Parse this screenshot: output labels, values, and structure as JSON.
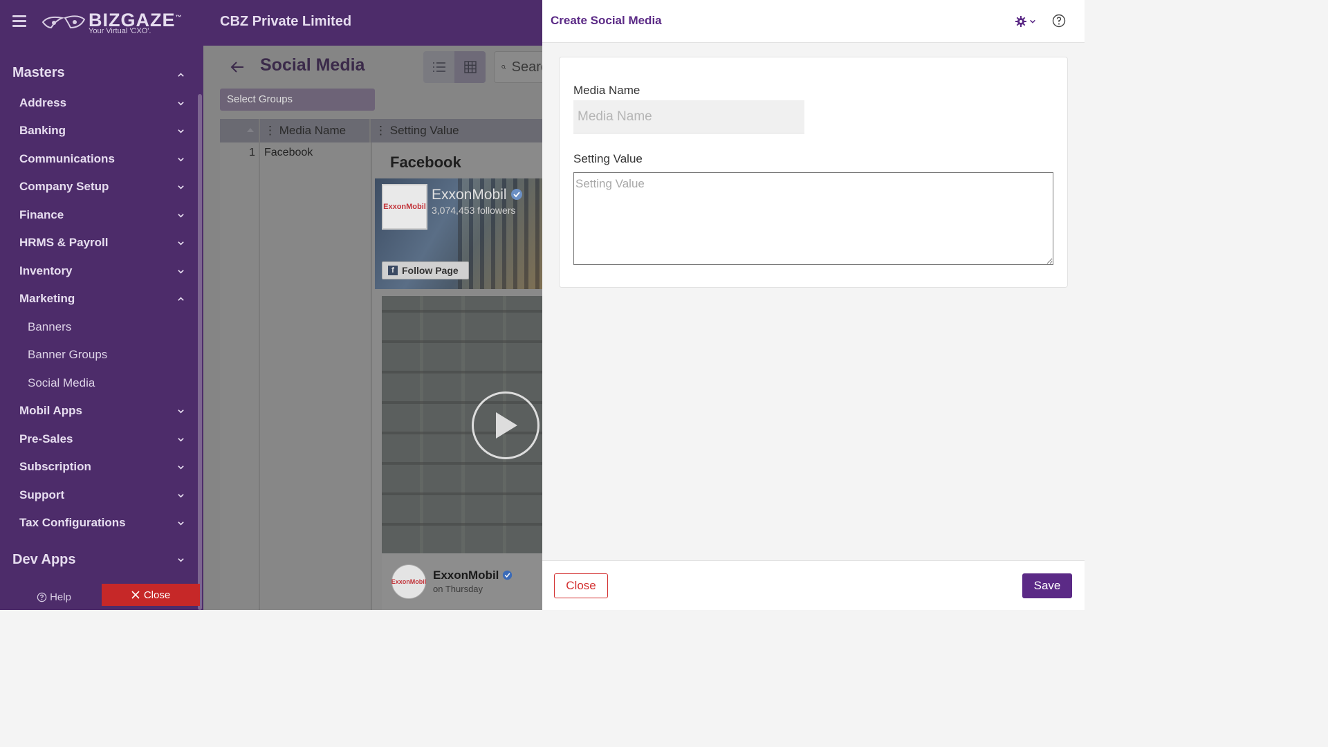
{
  "header": {
    "brand_name": "BIZGAZE",
    "brand_tm": "™",
    "brand_tagline": "Your Virtual 'CXO'.",
    "company": "CBZ Private Limited"
  },
  "sidebar": {
    "section": "Masters",
    "items": [
      {
        "label": "Address"
      },
      {
        "label": "Banking"
      },
      {
        "label": "Communications"
      },
      {
        "label": "Company Setup"
      },
      {
        "label": "Finance"
      },
      {
        "label": "HRMS & Payroll"
      },
      {
        "label": "Inventory"
      },
      {
        "label": "Marketing"
      },
      {
        "label": "Mobil Apps"
      },
      {
        "label": "Pre-Sales"
      },
      {
        "label": "Subscription"
      },
      {
        "label": "Support"
      },
      {
        "label": "Tax Configurations"
      }
    ],
    "marketing_children": [
      {
        "label": "Banners"
      },
      {
        "label": "Banner Groups"
      },
      {
        "label": "Social Media"
      }
    ],
    "dev_apps": "Dev Apps",
    "help": "Help",
    "close": "Close"
  },
  "main": {
    "title": "Social Media",
    "search_placeholder": "Search",
    "select_groups": "Select Groups",
    "columns": [
      "Media Name",
      "Setting Value"
    ],
    "rows": [
      {
        "num": "1",
        "name": "Facebook"
      }
    ],
    "preview": {
      "title": "Facebook",
      "page_name": "ExxonMobil",
      "followers": "3,074,453 followers",
      "follow_button": "Follow Page",
      "logo_text": "ExxonMobil",
      "post_author": "ExxonMobil",
      "post_time": "on Thursday"
    }
  },
  "drawer": {
    "title": "Create Social Media",
    "fields": {
      "media_name_label": "Media Name",
      "media_name_placeholder": "Media Name",
      "setting_value_label": "Setting Value",
      "setting_value_placeholder": "Setting Value"
    },
    "close_button": "Close",
    "save_button": "Save"
  },
  "colors": {
    "brand_purple": "#4d2c6a",
    "accent_purple": "#5b2a86",
    "danger_red": "#d32f2f"
  },
  "icons": [
    "hamburger-icon",
    "chevron-down-icon",
    "chevron-up-icon",
    "back-arrow-icon",
    "list-view-icon",
    "grid-view-icon",
    "search-icon",
    "gear-icon",
    "help-circle-icon",
    "close-x-icon",
    "play-icon",
    "verified-badge-icon",
    "facebook-logo-icon"
  ]
}
